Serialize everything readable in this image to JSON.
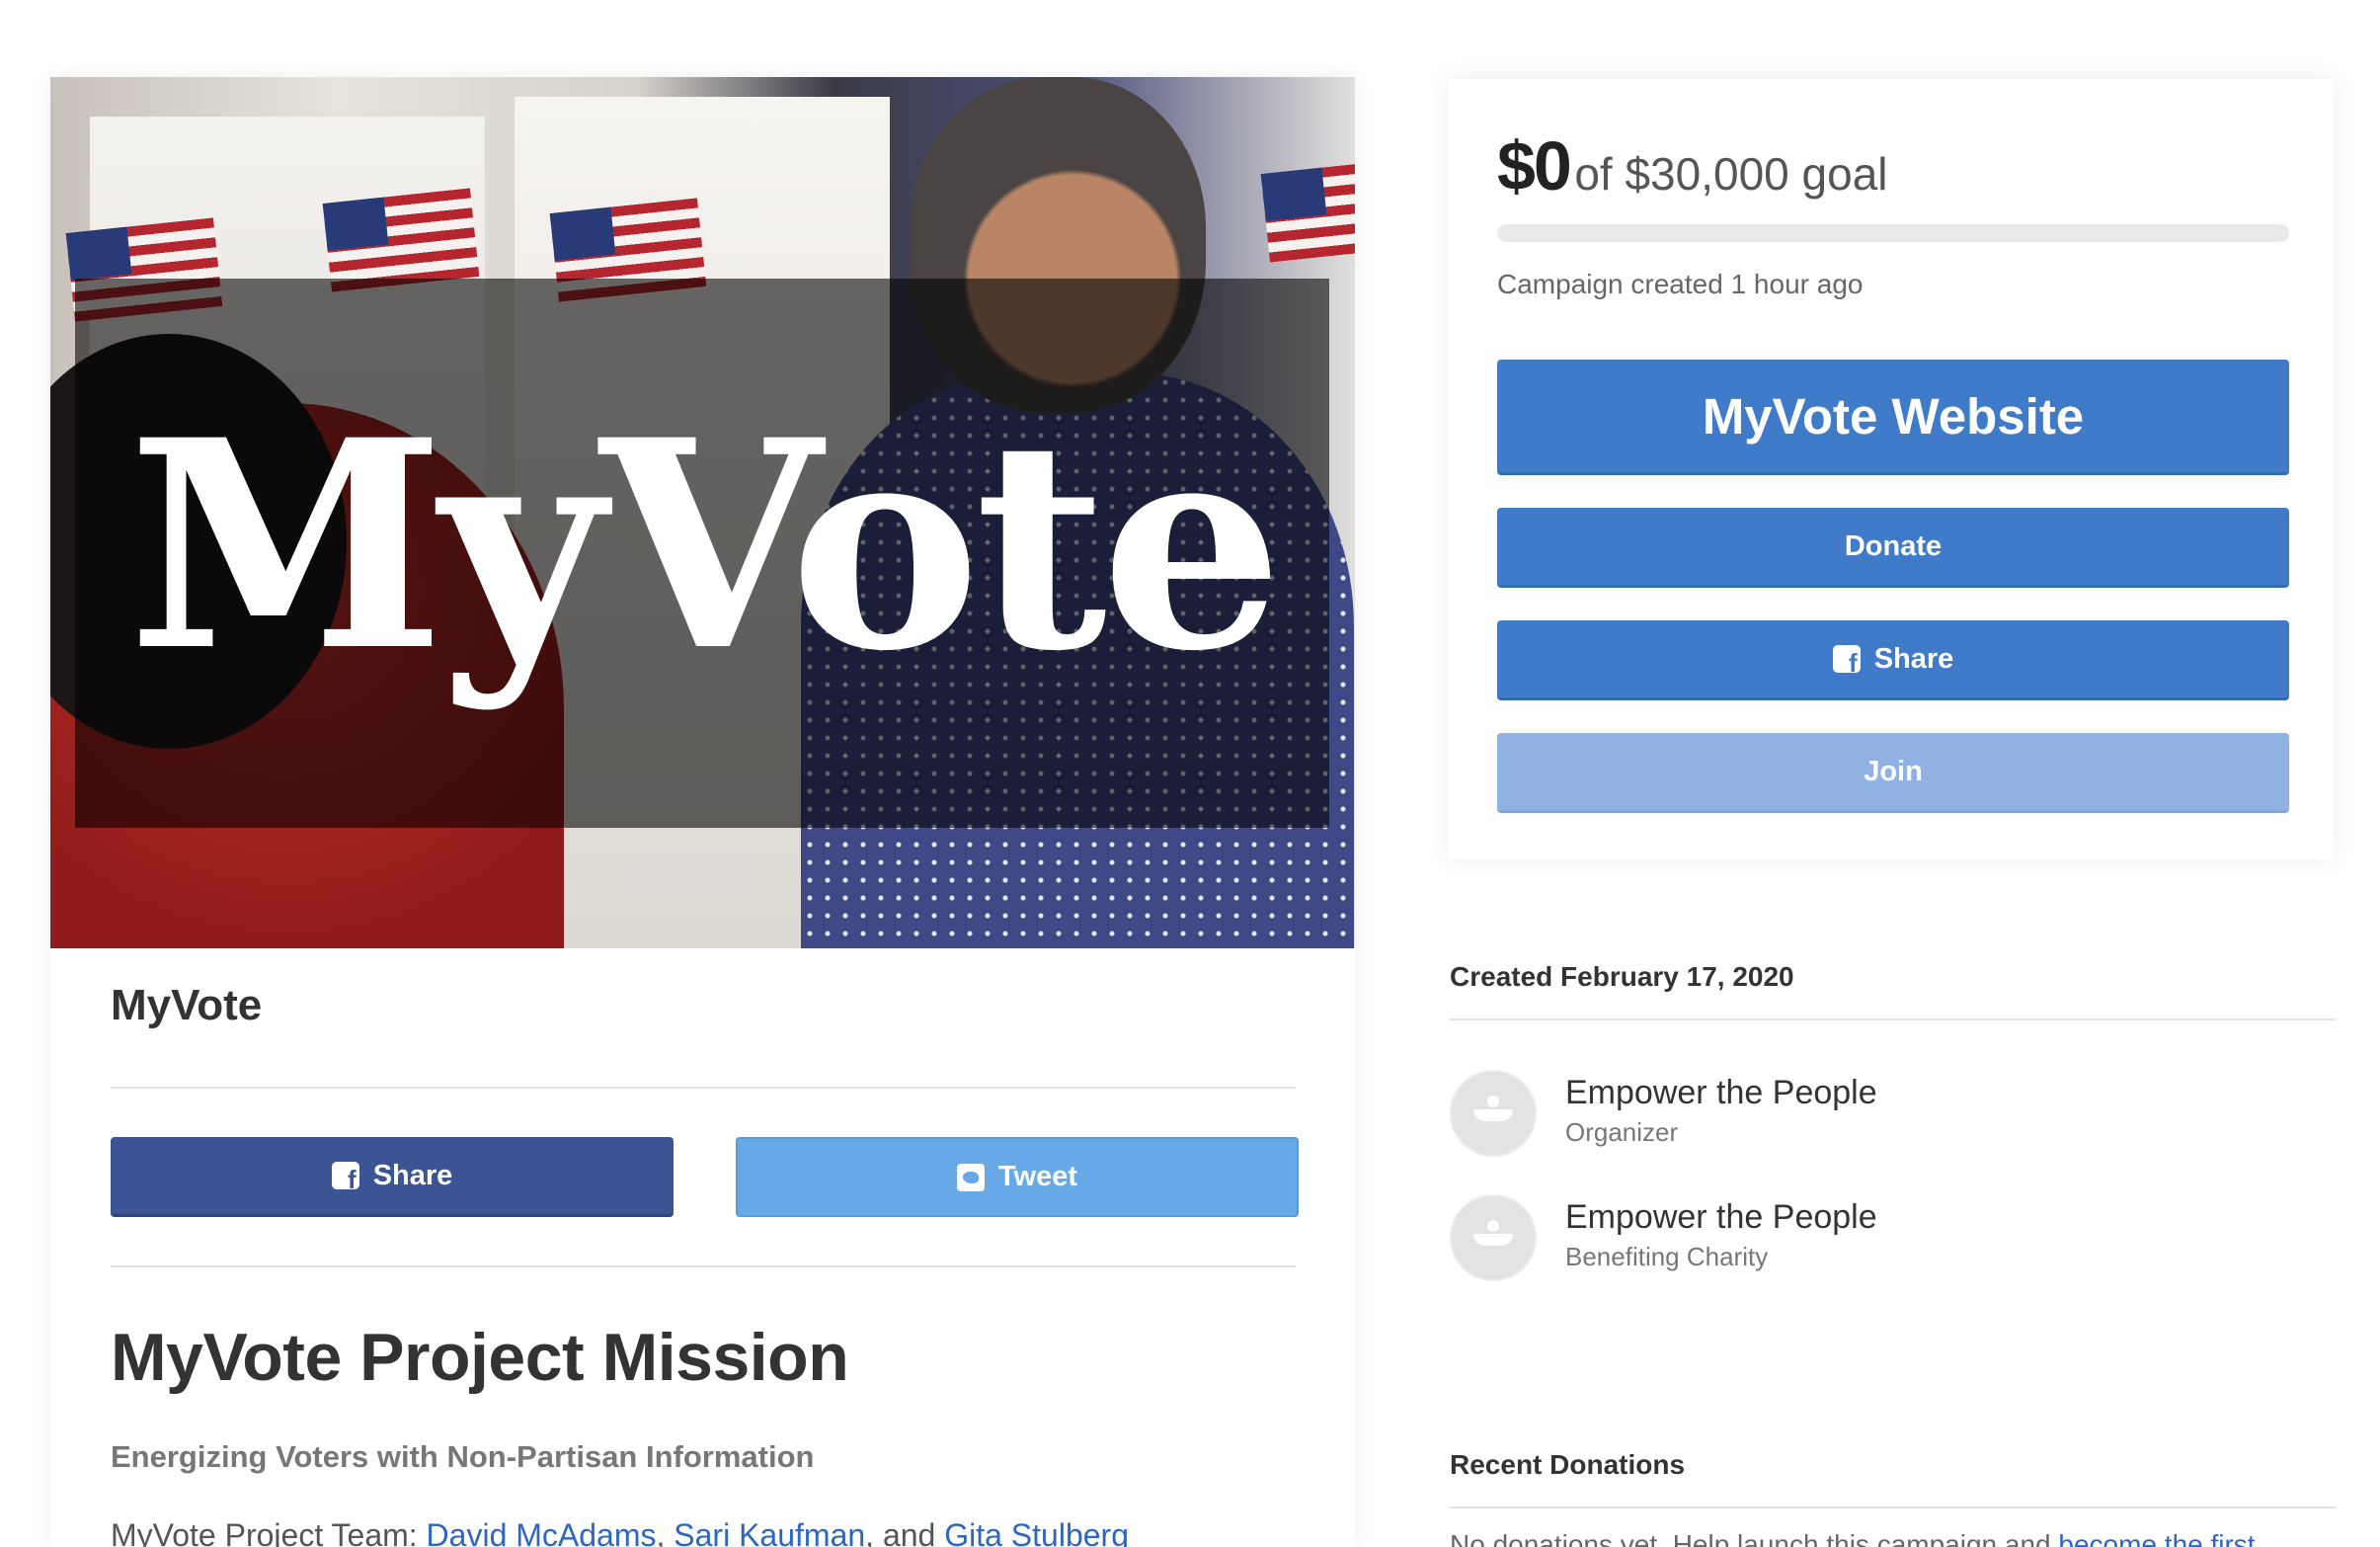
{
  "hero": {
    "logo_text": "MyVote"
  },
  "campaign": {
    "title": "MyVote",
    "share_label": "Share",
    "tweet_label": "Tweet"
  },
  "mission": {
    "title": "MyVote Project Mission",
    "subtitle": "Energizing Voters with Non-Partisan Information",
    "team_prefix": "MyVote Project Team: ",
    "team_members": [
      "David McAdams",
      "Sari Kaufman",
      "Gita Stulberg"
    ],
    "separator_1": ", ",
    "separator_2": ", and "
  },
  "fundraising": {
    "raised": "$0",
    "goal_text": "of $30,000 goal",
    "progress_percent": 0,
    "created_ago": "Campaign created 1 hour ago",
    "website_label": "MyVote Website",
    "donate_label": "Donate",
    "share_label": "Share",
    "join_label": "Join"
  },
  "details": {
    "created_date": "Created February 17, 2020",
    "organizers": [
      {
        "name": "Empower the People",
        "role": "Organizer"
      },
      {
        "name": "Empower the People",
        "role": "Benefiting Charity"
      }
    ]
  },
  "donations": {
    "heading": "Recent Donations",
    "empty_text": "No donations yet. Help launch this campaign and ",
    "empty_link": "become the first"
  },
  "colors": {
    "primary_blue": "#3f7bc9",
    "facebook_blue": "#3b5493",
    "twitter_blue": "#66a9e6",
    "join_light_blue": "#8fb2e2",
    "link_blue": "#2d66c2"
  },
  "icons": [
    "facebook-icon",
    "twitter-icon",
    "organization-avatar-icon"
  ]
}
